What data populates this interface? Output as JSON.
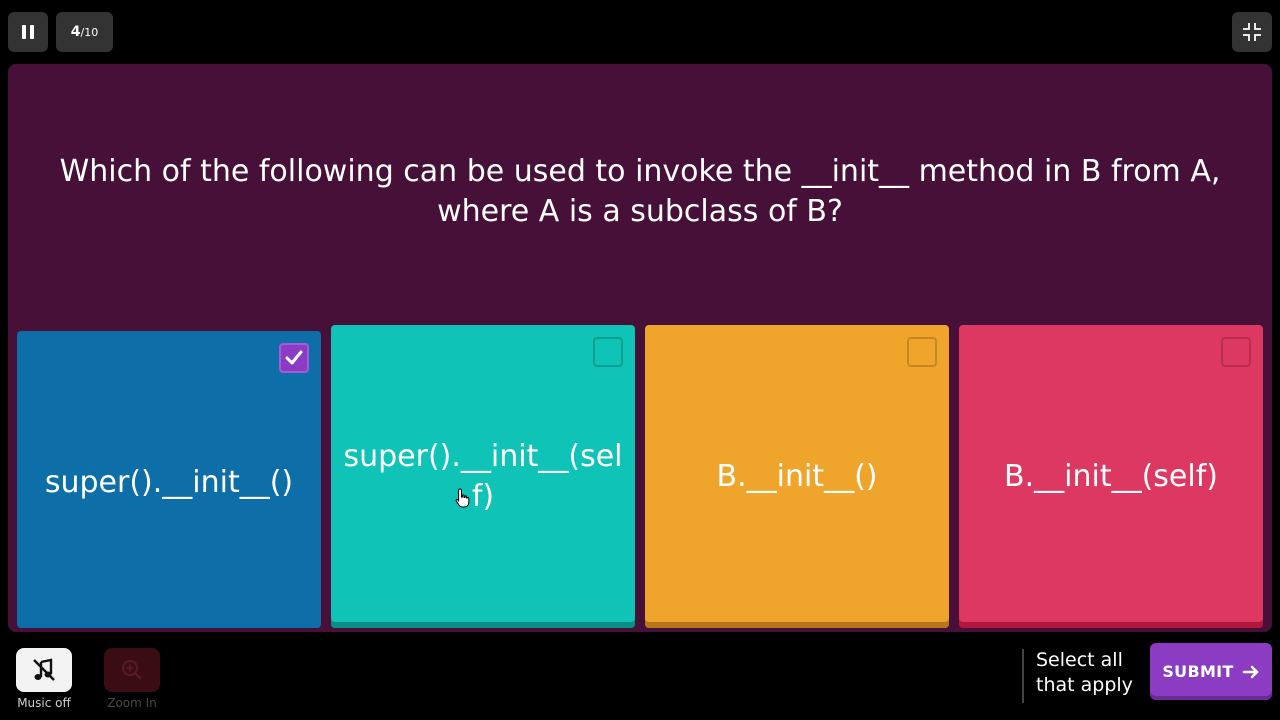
{
  "header": {
    "progress_current": "4",
    "progress_total": "/10"
  },
  "question": {
    "text": "Which of the following can be used to invoke the __init__ method in B from A, where A is a subclass of B?"
  },
  "options": [
    {
      "label": "super().__init__()",
      "checked": true,
      "color": "#0e6ea8"
    },
    {
      "label": "super().__init__(self)",
      "checked": false,
      "color": "#0fc4b6"
    },
    {
      "label": "B.__init__()",
      "checked": false,
      "color": "#efa52b"
    },
    {
      "label": "B.__init__(self)",
      "checked": false,
      "color": "#dd3861"
    }
  ],
  "footer": {
    "music_label": "Music off",
    "zoom_label": "Zoom In",
    "hint": "Select all that apply",
    "submit_label": "SUBMIT"
  },
  "icons": {
    "pause": "pause-icon",
    "collapse": "collapse-icon",
    "music": "music-off-icon",
    "zoom": "zoom-in-icon",
    "submit_arrow": "arrow-right-icon",
    "check": "check-icon"
  }
}
